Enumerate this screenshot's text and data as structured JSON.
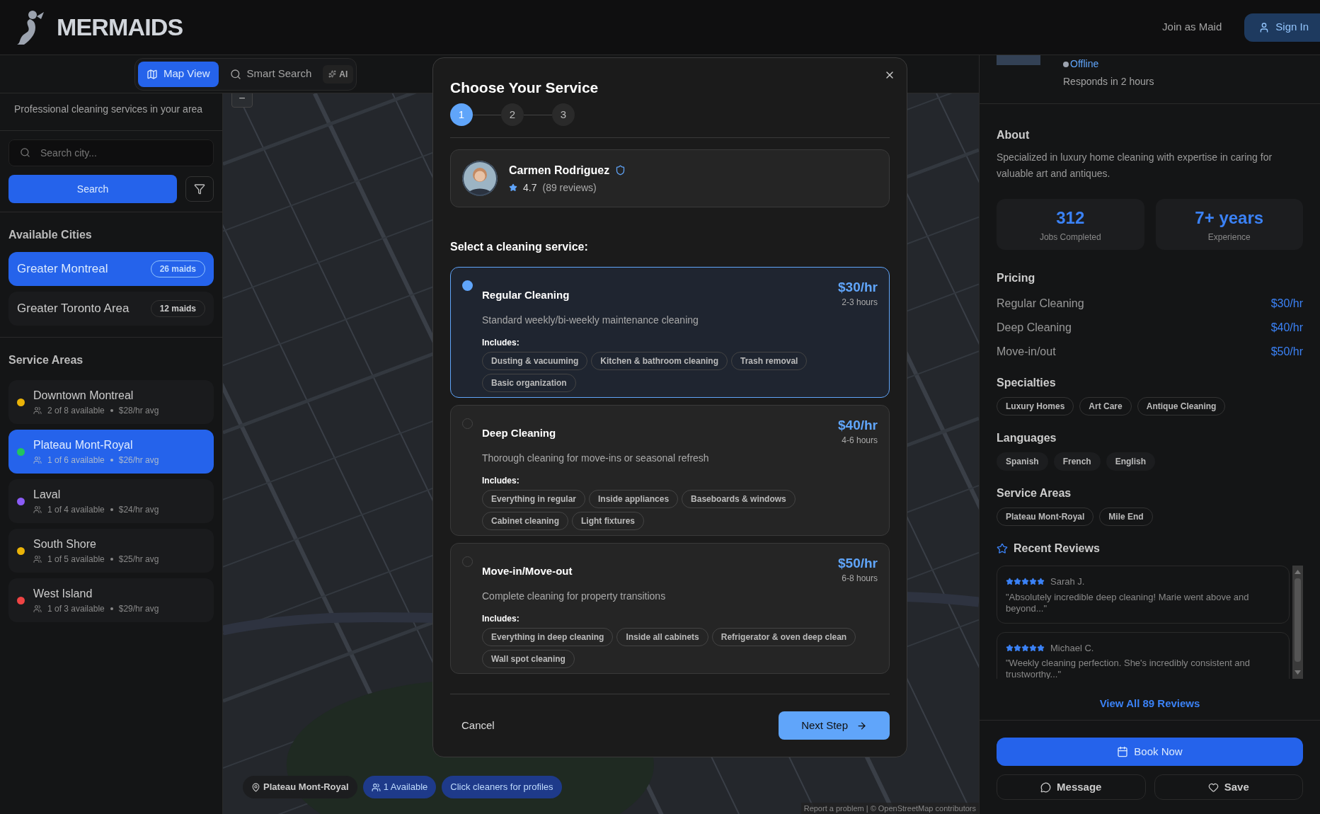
{
  "header": {
    "brand": "MERMAIDS",
    "join_link": "Join as Maid",
    "sign_in": "Sign In"
  },
  "view_tabs": [
    {
      "label": "Map View",
      "selected": true
    },
    {
      "label": "Smart Search",
      "selected": false
    }
  ],
  "ai_badge": "AI",
  "sidebar": {
    "tagline": "Professional cleaning services in your area",
    "search_placeholder": "Search city...",
    "search_button": "Search",
    "cities_heading": "Available Cities",
    "cities": [
      {
        "name": "Greater Montreal",
        "count": "26 maids",
        "selected": true
      },
      {
        "name": "Greater Toronto Area",
        "count": "12 maids",
        "selected": false
      }
    ],
    "areas_heading": "Service Areas",
    "areas": [
      {
        "name": "Downtown Montreal",
        "available": "2 of 8 available",
        "rate": "$28/hr avg",
        "color": "#eab308",
        "selected": false
      },
      {
        "name": "Plateau Mont-Royal",
        "available": "1 of 6 available",
        "rate": "$26/hr avg",
        "color": "#22c55e",
        "selected": true
      },
      {
        "name": "Laval",
        "available": "1 of 4 available",
        "rate": "$24/hr avg",
        "color": "#8b5cf6",
        "selected": false
      },
      {
        "name": "South Shore",
        "available": "1 of 5 available",
        "rate": "$25/hr avg",
        "color": "#eab308",
        "selected": false
      },
      {
        "name": "West Island",
        "available": "1 of 3 available",
        "rate": "$29/hr avg",
        "color": "#ef4444",
        "selected": false
      }
    ]
  },
  "map": {
    "zoom_out": "−",
    "chips": [
      {
        "kind": "location",
        "label": "Plateau Mont-Royal"
      },
      {
        "kind": "count",
        "label": "1 Available"
      },
      {
        "kind": "hint",
        "label": "Click cleaners for profiles"
      }
    ],
    "attribution": "Report a problem | © OpenStreetMap contributors"
  },
  "profile": {
    "status": "Offline",
    "response": "Responds in 2 hours",
    "about_heading": "About",
    "about": "Specialized in luxury home cleaning with expertise in caring for valuable art and antiques.",
    "stats": [
      {
        "value": "312",
        "label": "Jobs Completed"
      },
      {
        "value": "7+ years",
        "label": "Experience"
      }
    ],
    "pricing_heading": "Pricing",
    "pricing": [
      {
        "name": "Regular Cleaning",
        "price": "$30/hr"
      },
      {
        "name": "Deep Cleaning",
        "price": "$40/hr"
      },
      {
        "name": "Move-in/out",
        "price": "$50/hr"
      }
    ],
    "specialties_heading": "Specialties",
    "specialties": [
      "Luxury Homes",
      "Art Care",
      "Antique Cleaning"
    ],
    "languages_heading": "Languages",
    "languages": [
      "Spanish",
      "French",
      "English"
    ],
    "areas_heading": "Service Areas",
    "areas": [
      "Plateau Mont-Royal",
      "Mile End"
    ],
    "reviews_heading": "Recent Reviews",
    "reviews": [
      {
        "author": "Sarah J.",
        "stars": 5,
        "text": "\"Absolutely incredible deep cleaning! Marie went above and beyond...\""
      },
      {
        "author": "Michael C.",
        "stars": 5,
        "text": "\"Weekly cleaning perfection. She's incredibly consistent and trustworthy...\""
      }
    ],
    "view_all": "View All 89 Reviews",
    "book": "Book Now",
    "message": "Message",
    "save": "Save"
  },
  "modal": {
    "title": "Choose Your Service",
    "steps": [
      {
        "label": "1",
        "active": true
      },
      {
        "label": "2",
        "active": false
      },
      {
        "label": "3",
        "active": false
      }
    ],
    "maid": {
      "name": "Carmen Rodriguez",
      "verified": true,
      "rating": "4.7",
      "reviews": "(89 reviews)"
    },
    "prompt": "Select a cleaning service:",
    "services": [
      {
        "name": "Regular Cleaning",
        "price": "$30/hr",
        "duration": "2-3 hours",
        "description": "Standard weekly/bi-weekly maintenance cleaning",
        "includes_label": "Includes:",
        "includes": [
          "Dusting & vacuuming",
          "Kitchen & bathroom cleaning",
          "Trash removal",
          "Basic organization"
        ],
        "selected": true
      },
      {
        "name": "Deep Cleaning",
        "price": "$40/hr",
        "duration": "4-6 hours",
        "description": "Thorough cleaning for move-ins or seasonal refresh",
        "includes_label": "Includes:",
        "includes": [
          "Everything in regular",
          "Inside appliances",
          "Baseboards & windows",
          "Cabinet cleaning",
          "Light fixtures"
        ],
        "selected": false
      },
      {
        "name": "Move-in/Move-out",
        "price": "$50/hr",
        "duration": "6-8 hours",
        "description": "Complete cleaning for property transitions",
        "includes_label": "Includes:",
        "includes": [
          "Everything in deep cleaning",
          "Inside all cabinets",
          "Refrigerator & oven deep clean",
          "Wall spot cleaning"
        ],
        "selected": false
      }
    ],
    "cancel": "Cancel",
    "next": "Next Step"
  }
}
